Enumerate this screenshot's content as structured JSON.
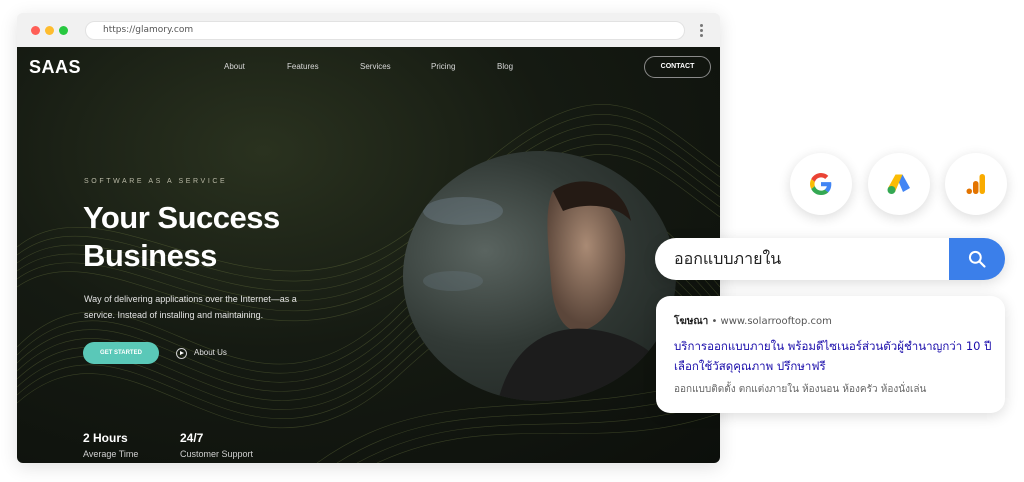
{
  "browser": {
    "url": "https://glamory.com",
    "menu_icon": "kebab-menu-icon"
  },
  "site": {
    "brand": "SAAS",
    "nav": [
      "About",
      "Features",
      "Services",
      "Pricing",
      "Blog"
    ],
    "contact_label": "CONTACT",
    "eyebrow": "SOFTWARE AS A SERVICE",
    "headline": "Your Success Business",
    "lede": "Way of delivering applications over the Internet—as a service. Instead of installing and maintaining.",
    "cta_label": "GET STARTED",
    "secondary_label": "About Us",
    "stats": [
      {
        "value": "2 Hours",
        "label": "Average Time"
      },
      {
        "value": "24/7",
        "label": "Customer Support"
      }
    ],
    "accent_color": "#5ac8b8"
  },
  "icons": [
    "google-icon",
    "google-ads-icon",
    "google-analytics-icon"
  ],
  "search": {
    "query": "ออกแบบภายใน",
    "button_icon": "search-icon",
    "button_color": "#3b7fea"
  },
  "ad": {
    "badge": "โฆษณา",
    "separator": " • ",
    "domain": "www.solarrooftop.com",
    "title": "บริการออกแบบภายใน พร้อมดีไซเนอร์ส่วนตัวผู้ชำนาญกว่า 10 ปี เลือกใช้วัสดุคุณภาพ ปรึกษาฟรี",
    "description": "ออกแบบติดตั้ง ตกแต่งภายใน ห้องนอน ห้องครัว ห้องนั่งเล่น",
    "title_color": "#1a0dab"
  }
}
